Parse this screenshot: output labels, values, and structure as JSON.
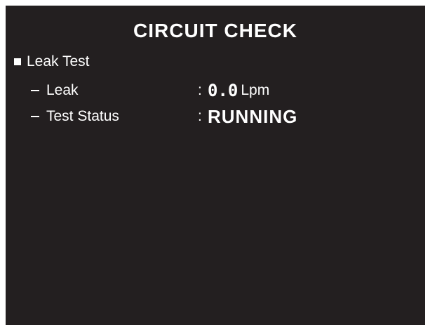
{
  "title": "CIRCUIT CHECK",
  "section": {
    "label": "Leak Test"
  },
  "rows": [
    {
      "label": "Leak",
      "separator": ":",
      "value": "0.0",
      "unit": "Lpm"
    },
    {
      "label": "Test Status",
      "separator": ":",
      "value": "RUNNING"
    }
  ],
  "colors": {
    "background": "#231f20",
    "text": "#ffffff"
  }
}
